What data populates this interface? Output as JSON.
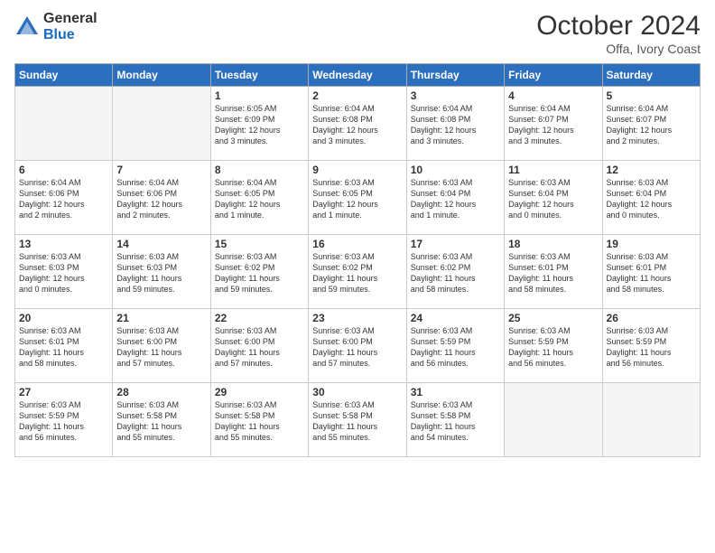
{
  "header": {
    "logo_general": "General",
    "logo_blue": "Blue",
    "month_title": "October 2024",
    "location": "Offa, Ivory Coast"
  },
  "days_of_week": [
    "Sunday",
    "Monday",
    "Tuesday",
    "Wednesday",
    "Thursday",
    "Friday",
    "Saturday"
  ],
  "weeks": [
    [
      {
        "day": "",
        "info": ""
      },
      {
        "day": "",
        "info": ""
      },
      {
        "day": "1",
        "info": "Sunrise: 6:05 AM\nSunset: 6:09 PM\nDaylight: 12 hours\nand 3 minutes."
      },
      {
        "day": "2",
        "info": "Sunrise: 6:04 AM\nSunset: 6:08 PM\nDaylight: 12 hours\nand 3 minutes."
      },
      {
        "day": "3",
        "info": "Sunrise: 6:04 AM\nSunset: 6:08 PM\nDaylight: 12 hours\nand 3 minutes."
      },
      {
        "day": "4",
        "info": "Sunrise: 6:04 AM\nSunset: 6:07 PM\nDaylight: 12 hours\nand 3 minutes."
      },
      {
        "day": "5",
        "info": "Sunrise: 6:04 AM\nSunset: 6:07 PM\nDaylight: 12 hours\nand 2 minutes."
      }
    ],
    [
      {
        "day": "6",
        "info": "Sunrise: 6:04 AM\nSunset: 6:06 PM\nDaylight: 12 hours\nand 2 minutes."
      },
      {
        "day": "7",
        "info": "Sunrise: 6:04 AM\nSunset: 6:06 PM\nDaylight: 12 hours\nand 2 minutes."
      },
      {
        "day": "8",
        "info": "Sunrise: 6:04 AM\nSunset: 6:05 PM\nDaylight: 12 hours\nand 1 minute."
      },
      {
        "day": "9",
        "info": "Sunrise: 6:03 AM\nSunset: 6:05 PM\nDaylight: 12 hours\nand 1 minute."
      },
      {
        "day": "10",
        "info": "Sunrise: 6:03 AM\nSunset: 6:04 PM\nDaylight: 12 hours\nand 1 minute."
      },
      {
        "day": "11",
        "info": "Sunrise: 6:03 AM\nSunset: 6:04 PM\nDaylight: 12 hours\nand 0 minutes."
      },
      {
        "day": "12",
        "info": "Sunrise: 6:03 AM\nSunset: 6:04 PM\nDaylight: 12 hours\nand 0 minutes."
      }
    ],
    [
      {
        "day": "13",
        "info": "Sunrise: 6:03 AM\nSunset: 6:03 PM\nDaylight: 12 hours\nand 0 minutes."
      },
      {
        "day": "14",
        "info": "Sunrise: 6:03 AM\nSunset: 6:03 PM\nDaylight: 11 hours\nand 59 minutes."
      },
      {
        "day": "15",
        "info": "Sunrise: 6:03 AM\nSunset: 6:02 PM\nDaylight: 11 hours\nand 59 minutes."
      },
      {
        "day": "16",
        "info": "Sunrise: 6:03 AM\nSunset: 6:02 PM\nDaylight: 11 hours\nand 59 minutes."
      },
      {
        "day": "17",
        "info": "Sunrise: 6:03 AM\nSunset: 6:02 PM\nDaylight: 11 hours\nand 58 minutes."
      },
      {
        "day": "18",
        "info": "Sunrise: 6:03 AM\nSunset: 6:01 PM\nDaylight: 11 hours\nand 58 minutes."
      },
      {
        "day": "19",
        "info": "Sunrise: 6:03 AM\nSunset: 6:01 PM\nDaylight: 11 hours\nand 58 minutes."
      }
    ],
    [
      {
        "day": "20",
        "info": "Sunrise: 6:03 AM\nSunset: 6:01 PM\nDaylight: 11 hours\nand 58 minutes."
      },
      {
        "day": "21",
        "info": "Sunrise: 6:03 AM\nSunset: 6:00 PM\nDaylight: 11 hours\nand 57 minutes."
      },
      {
        "day": "22",
        "info": "Sunrise: 6:03 AM\nSunset: 6:00 PM\nDaylight: 11 hours\nand 57 minutes."
      },
      {
        "day": "23",
        "info": "Sunrise: 6:03 AM\nSunset: 6:00 PM\nDaylight: 11 hours\nand 57 minutes."
      },
      {
        "day": "24",
        "info": "Sunrise: 6:03 AM\nSunset: 5:59 PM\nDaylight: 11 hours\nand 56 minutes."
      },
      {
        "day": "25",
        "info": "Sunrise: 6:03 AM\nSunset: 5:59 PM\nDaylight: 11 hours\nand 56 minutes."
      },
      {
        "day": "26",
        "info": "Sunrise: 6:03 AM\nSunset: 5:59 PM\nDaylight: 11 hours\nand 56 minutes."
      }
    ],
    [
      {
        "day": "27",
        "info": "Sunrise: 6:03 AM\nSunset: 5:59 PM\nDaylight: 11 hours\nand 56 minutes."
      },
      {
        "day": "28",
        "info": "Sunrise: 6:03 AM\nSunset: 5:58 PM\nDaylight: 11 hours\nand 55 minutes."
      },
      {
        "day": "29",
        "info": "Sunrise: 6:03 AM\nSunset: 5:58 PM\nDaylight: 11 hours\nand 55 minutes."
      },
      {
        "day": "30",
        "info": "Sunrise: 6:03 AM\nSunset: 5:58 PM\nDaylight: 11 hours\nand 55 minutes."
      },
      {
        "day": "31",
        "info": "Sunrise: 6:03 AM\nSunset: 5:58 PM\nDaylight: 11 hours\nand 54 minutes."
      },
      {
        "day": "",
        "info": ""
      },
      {
        "day": "",
        "info": ""
      }
    ]
  ]
}
